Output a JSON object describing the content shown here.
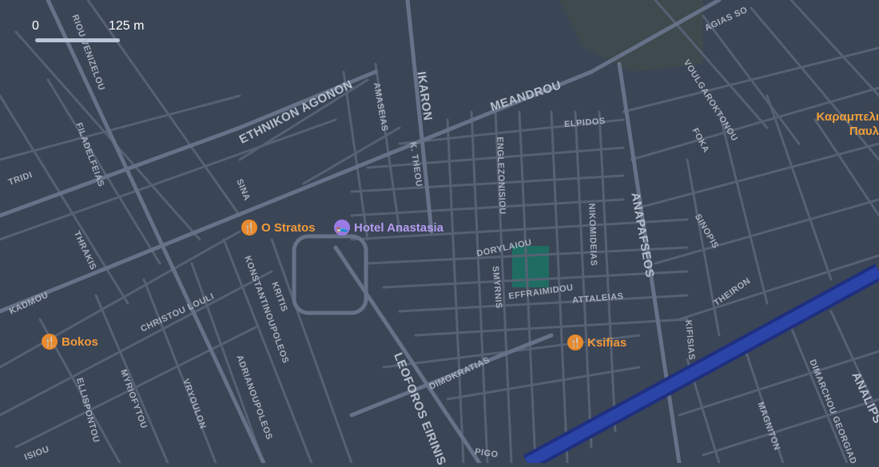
{
  "scale": {
    "zero": "0",
    "distance": "125 m"
  },
  "colors": {
    "background": "#3a4556",
    "road": "#5a6678",
    "major_road": "#6a7689",
    "highway": "#2a3f9a",
    "park": "#1f6d62",
    "restaurant": "#e98a2c",
    "hotel": "#9b7ae6"
  },
  "streets": [
    {
      "name": "RIOU VENIZELOU"
    },
    {
      "name": "ETHNIKON AGONON"
    },
    {
      "name": "AMASEIAS"
    },
    {
      "name": "IKARON"
    },
    {
      "name": "MEANDROU"
    },
    {
      "name": "ELPIDOS"
    },
    {
      "name": "AGIAS SO"
    },
    {
      "name": "VOULGAROKTONOU"
    },
    {
      "name": "FOKA"
    },
    {
      "name": "FILADELFEIAS"
    },
    {
      "name": "TRIDI"
    },
    {
      "name": "K. THEOU"
    },
    {
      "name": "ENGLEZONISIOU"
    },
    {
      "name": "SINA"
    },
    {
      "name": "ANAPAFSEOS"
    },
    {
      "name": "SINOPIS"
    },
    {
      "name": "THRAKIS"
    },
    {
      "name": "KONSTANTINOUPOLEOS"
    },
    {
      "name": "KRITIS"
    },
    {
      "name": "DORYLAIOU"
    },
    {
      "name": "SMYRNIS"
    },
    {
      "name": "NIKOMIDEIAS"
    },
    {
      "name": "EFFRAIMIDOU"
    },
    {
      "name": "ATTALEIAS"
    },
    {
      "name": "KADMOU"
    },
    {
      "name": "CHRISTOU LOULI"
    },
    {
      "name": "THEIRON"
    },
    {
      "name": "KIFISIAS"
    },
    {
      "name": "DIMOKRATIAS"
    },
    {
      "name": "LEOFOROS EIRINIS"
    },
    {
      "name": "ADRIANOUPOLEOS"
    },
    {
      "name": "MYRIOFYTOU"
    },
    {
      "name": "VRYOULON"
    },
    {
      "name": "ELLISPONTOU"
    },
    {
      "name": "MAGNITON"
    },
    {
      "name": "DIMARCHOU GEORGIAD"
    },
    {
      "name": "ANALIPS"
    },
    {
      "name": "PIGO"
    },
    {
      "name": "ISIOU"
    }
  ],
  "pois": [
    {
      "name": "O Stratos",
      "type": "restaurant",
      "icon": "restaurant-icon"
    },
    {
      "name": "Hotel Anastasia",
      "type": "hotel",
      "icon": "hotel-icon"
    },
    {
      "name": "Bokos",
      "type": "restaurant",
      "icon": "restaurant-icon"
    },
    {
      "name": "Ksifias",
      "type": "restaurant",
      "icon": "restaurant-icon"
    }
  ],
  "edge_place": {
    "line1": "Καραμπελι",
    "line2": "Παυλ"
  }
}
